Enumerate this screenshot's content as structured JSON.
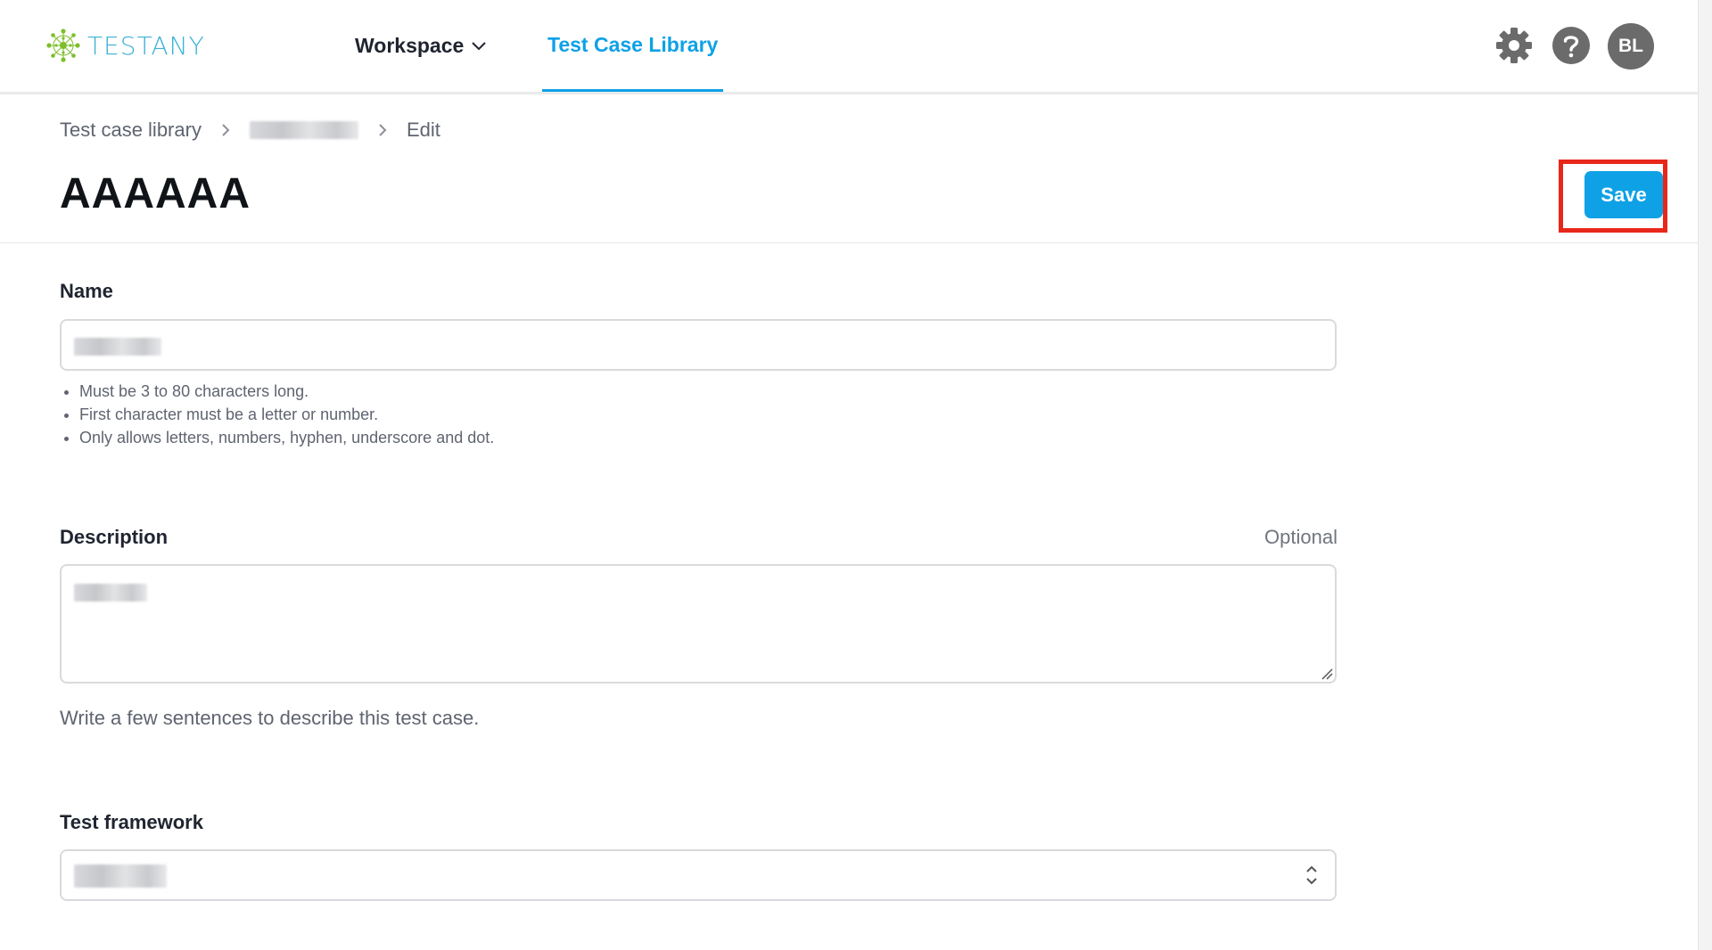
{
  "brand": {
    "name": "TESTANY",
    "color": "#3cb2d6",
    "mark_color": "#7cbf2a"
  },
  "nav": {
    "workspace_label": "Workspace",
    "library_label": "Test Case Library",
    "active_color": "#0ea1e6"
  },
  "header_icons": {
    "settings": "gear-icon",
    "help": "help-icon",
    "avatar_initials": "BL"
  },
  "breadcrumb": {
    "root": "Test case library",
    "current": "Edit"
  },
  "page": {
    "title": "AAAAAA",
    "save_label": "Save"
  },
  "form": {
    "name": {
      "label": "Name",
      "rules": [
        "Must be 3 to 80 characters long.",
        "First character must be a letter or number.",
        "Only allows letters, numbers, hyphen, underscore and dot."
      ]
    },
    "description": {
      "label": "Description",
      "optional_label": "Optional",
      "helper": "Write a few sentences to describe this test case."
    },
    "framework": {
      "label": "Test framework"
    }
  }
}
